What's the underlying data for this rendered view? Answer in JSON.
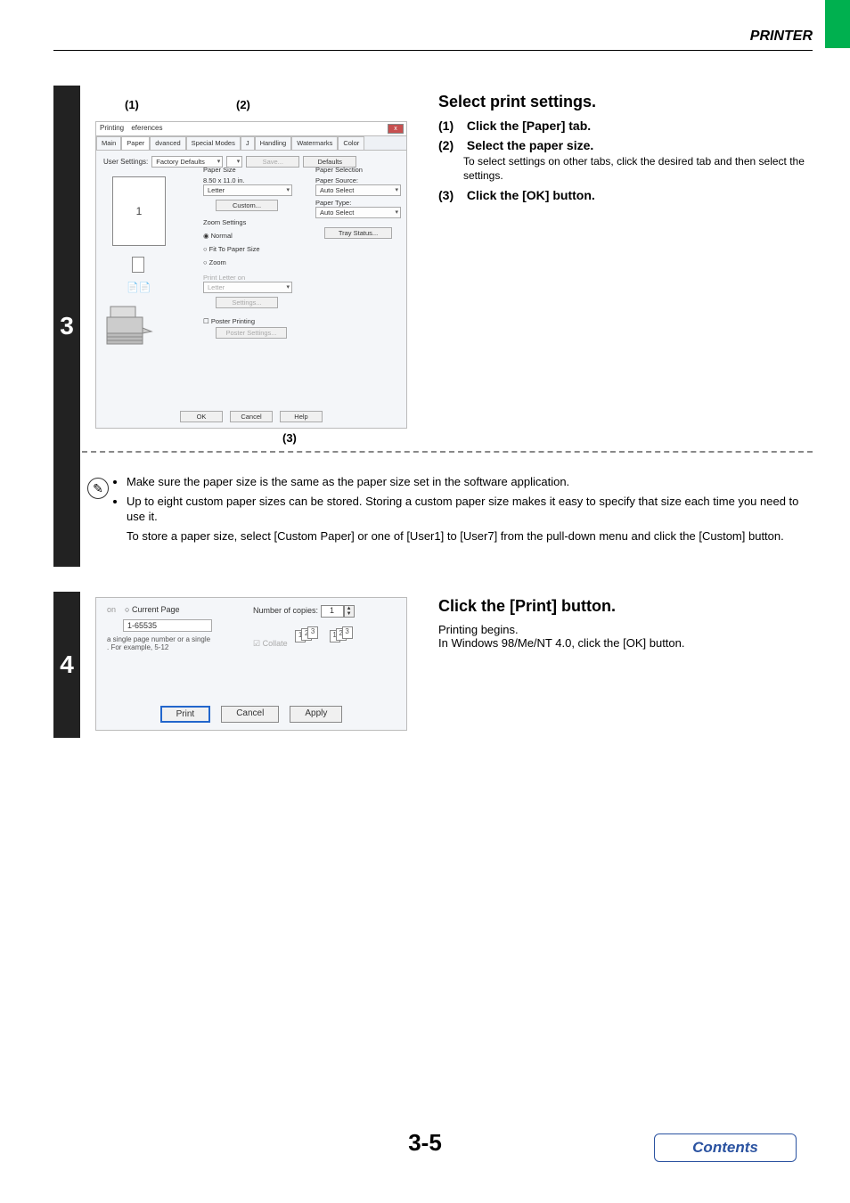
{
  "header": {
    "section_title": "PRINTER"
  },
  "step3": {
    "number": "3",
    "callouts": {
      "c1": "(1)",
      "c2": "(2)",
      "c3": "(3)"
    },
    "dialog": {
      "title_prefix": "Printing",
      "title_suffix": "eferences",
      "close": "x",
      "tabs": [
        "Main",
        "Paper",
        "dvanced",
        "Special Modes",
        "J",
        "Handling",
        "Watermarks",
        "Color"
      ],
      "user_settings_label": "User Settings:",
      "user_settings_value": "Factory Defaults",
      "save_btn": "Save...",
      "defaults_btn": "Defaults",
      "paper_size_label": "Paper Size",
      "paper_size_dim": "8.50 x 11.0 in.",
      "paper_size_value": "Letter",
      "custom_btn": "Custom...",
      "zoom_label": "Zoom Settings",
      "zoom_normal": "Normal",
      "zoom_fit": "Fit To Paper Size",
      "zoom_zoom": "Zoom",
      "print_letter_on_label": "Print Letter on",
      "print_letter_on_value": "Letter",
      "settings_btn": "Settings...",
      "poster_checkbox": "Poster Printing",
      "poster_settings_btn": "Poster Settings...",
      "paper_selection_label": "Paper Selection",
      "paper_source_label": "Paper Source:",
      "paper_source_value": "Auto Select",
      "paper_type_label": "Paper Type:",
      "paper_type_value": "Auto Select",
      "tray_status_btn": "Tray Status...",
      "preview_number": "1",
      "ok_btn": "OK",
      "cancel_btn": "Cancel",
      "help_btn": "Help"
    },
    "instructions": {
      "title": "Select print settings.",
      "items": [
        {
          "num": "(1)",
          "text": "Click the [Paper] tab.",
          "sub": ""
        },
        {
          "num": "(2)",
          "text": "Select the paper size.",
          "sub": "To select settings on other tabs, click the desired tab and then select the settings."
        },
        {
          "num": "(3)",
          "text": "Click the [OK] button.",
          "sub": ""
        }
      ]
    },
    "notes": {
      "bullet1": "Make sure the paper size is the same as the paper size set in the software application.",
      "bullet2": "Up to eight custom paper sizes can be stored. Storing a custom paper size makes it easy to specify that size each time you need to use it.",
      "bullet2_cont": "To store a paper size, select [Custom Paper] or one of [User1] to [User7] from the pull-down menu and click the [Custom] button."
    }
  },
  "step4": {
    "number": "4",
    "dialog": {
      "left_partial_on": "on",
      "current_page": "Current Page",
      "range": "1-65535",
      "hint1": "a single page number or a single",
      "hint2": ".   For example, 5-12",
      "copies_label": "Number of copies:",
      "copies_value": "1",
      "collate_label": "Collate",
      "icon_digits": "123",
      "print_btn": "Print",
      "cancel_btn": "Cancel",
      "apply_btn": "Apply"
    },
    "instructions": {
      "title": "Click the [Print] button.",
      "line1": "Printing begins.",
      "line2": "In Windows 98/Me/NT 4.0, click the [OK] button."
    }
  },
  "footer": {
    "page_number": "3-5",
    "contents": "Contents"
  }
}
